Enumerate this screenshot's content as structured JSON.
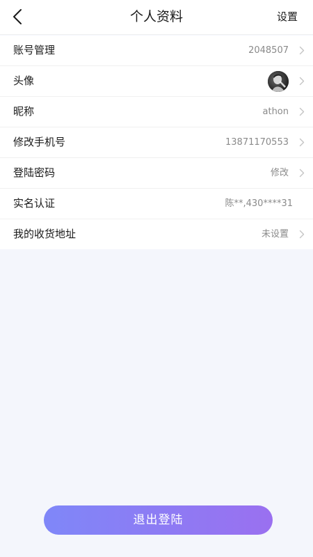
{
  "header": {
    "title": "个人资料",
    "settings_label": "设置",
    "back_icon": "chevron-left-icon"
  },
  "rows": [
    {
      "label": "账号管理",
      "value": "2048507",
      "chevron": true
    },
    {
      "label": "头像",
      "value": "",
      "chevron": true,
      "avatar_icon": "avatar-photo"
    },
    {
      "label": "昵称",
      "value": "athon",
      "chevron": true
    },
    {
      "label": "修改手机号",
      "value": "13871170553",
      "chevron": true
    },
    {
      "label": "登陆密码",
      "value": "修改",
      "chevron": true
    },
    {
      "label": "实名认证",
      "value": "陈**,430****31",
      "chevron": false
    },
    {
      "label": "我的收货地址",
      "value": "未设置",
      "chevron": true
    }
  ],
  "logout_label": "退出登陆",
  "colors": {
    "background": "#f4f6fc",
    "button_gradient_start": "#7f87f8",
    "button_gradient_end": "#9a70f0",
    "value_text": "#8a8a8a",
    "chevron": "#c4c4c4"
  }
}
